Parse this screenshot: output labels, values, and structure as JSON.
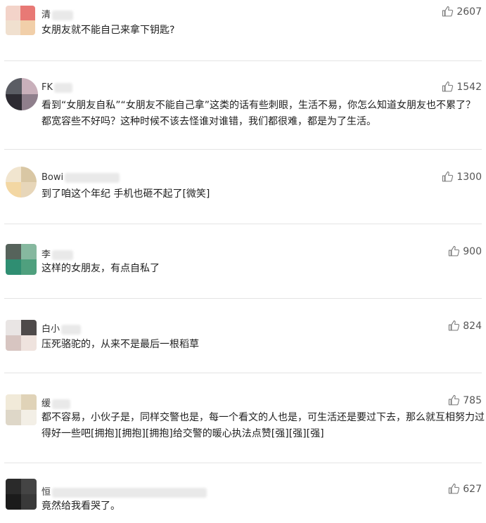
{
  "comments": [
    {
      "name": "清",
      "likes": "2607",
      "text": "女朋友就不能自己来拿下钥匙?"
    },
    {
      "name": "FK",
      "likes": "1542",
      "text": "看到“女朋友自私”“女朋友不能自己拿”这类的话有些刺眼，生活不易，你怎么知道女朋友也不累了？都宽容些不好吗？这种时候不该去怪谁对谁错，我们都很难，都是为了生活。"
    },
    {
      "name": "Bowi",
      "likes": "1300",
      "text": "到了咱这个年纪 手机也砸不起了[微笑]"
    },
    {
      "name": "李",
      "likes": "900",
      "text": "这样的女朋友，有点自私了"
    },
    {
      "name": "白小",
      "likes": "824",
      "text": "压死骆驼的，从来不是最后一根稻草"
    },
    {
      "name": "缓",
      "likes": "785",
      "text": "都不容易，小伙子是，同样交警也是，每一个看文的人也是，可生活还是要过下去，那么就互相努力过得好一些吧[拥抱][拥抱][拥抱]给交警的暖心执法点赞[强][强][强]"
    },
    {
      "name": "恒",
      "likes": "627",
      "text": "竟然给我看哭了。"
    }
  ],
  "icons": {
    "like": "thumbs-up-icon"
  },
  "colors": {
    "text": "#1e1e1e",
    "muted": "#555555",
    "divider": "#e4e4e4"
  }
}
